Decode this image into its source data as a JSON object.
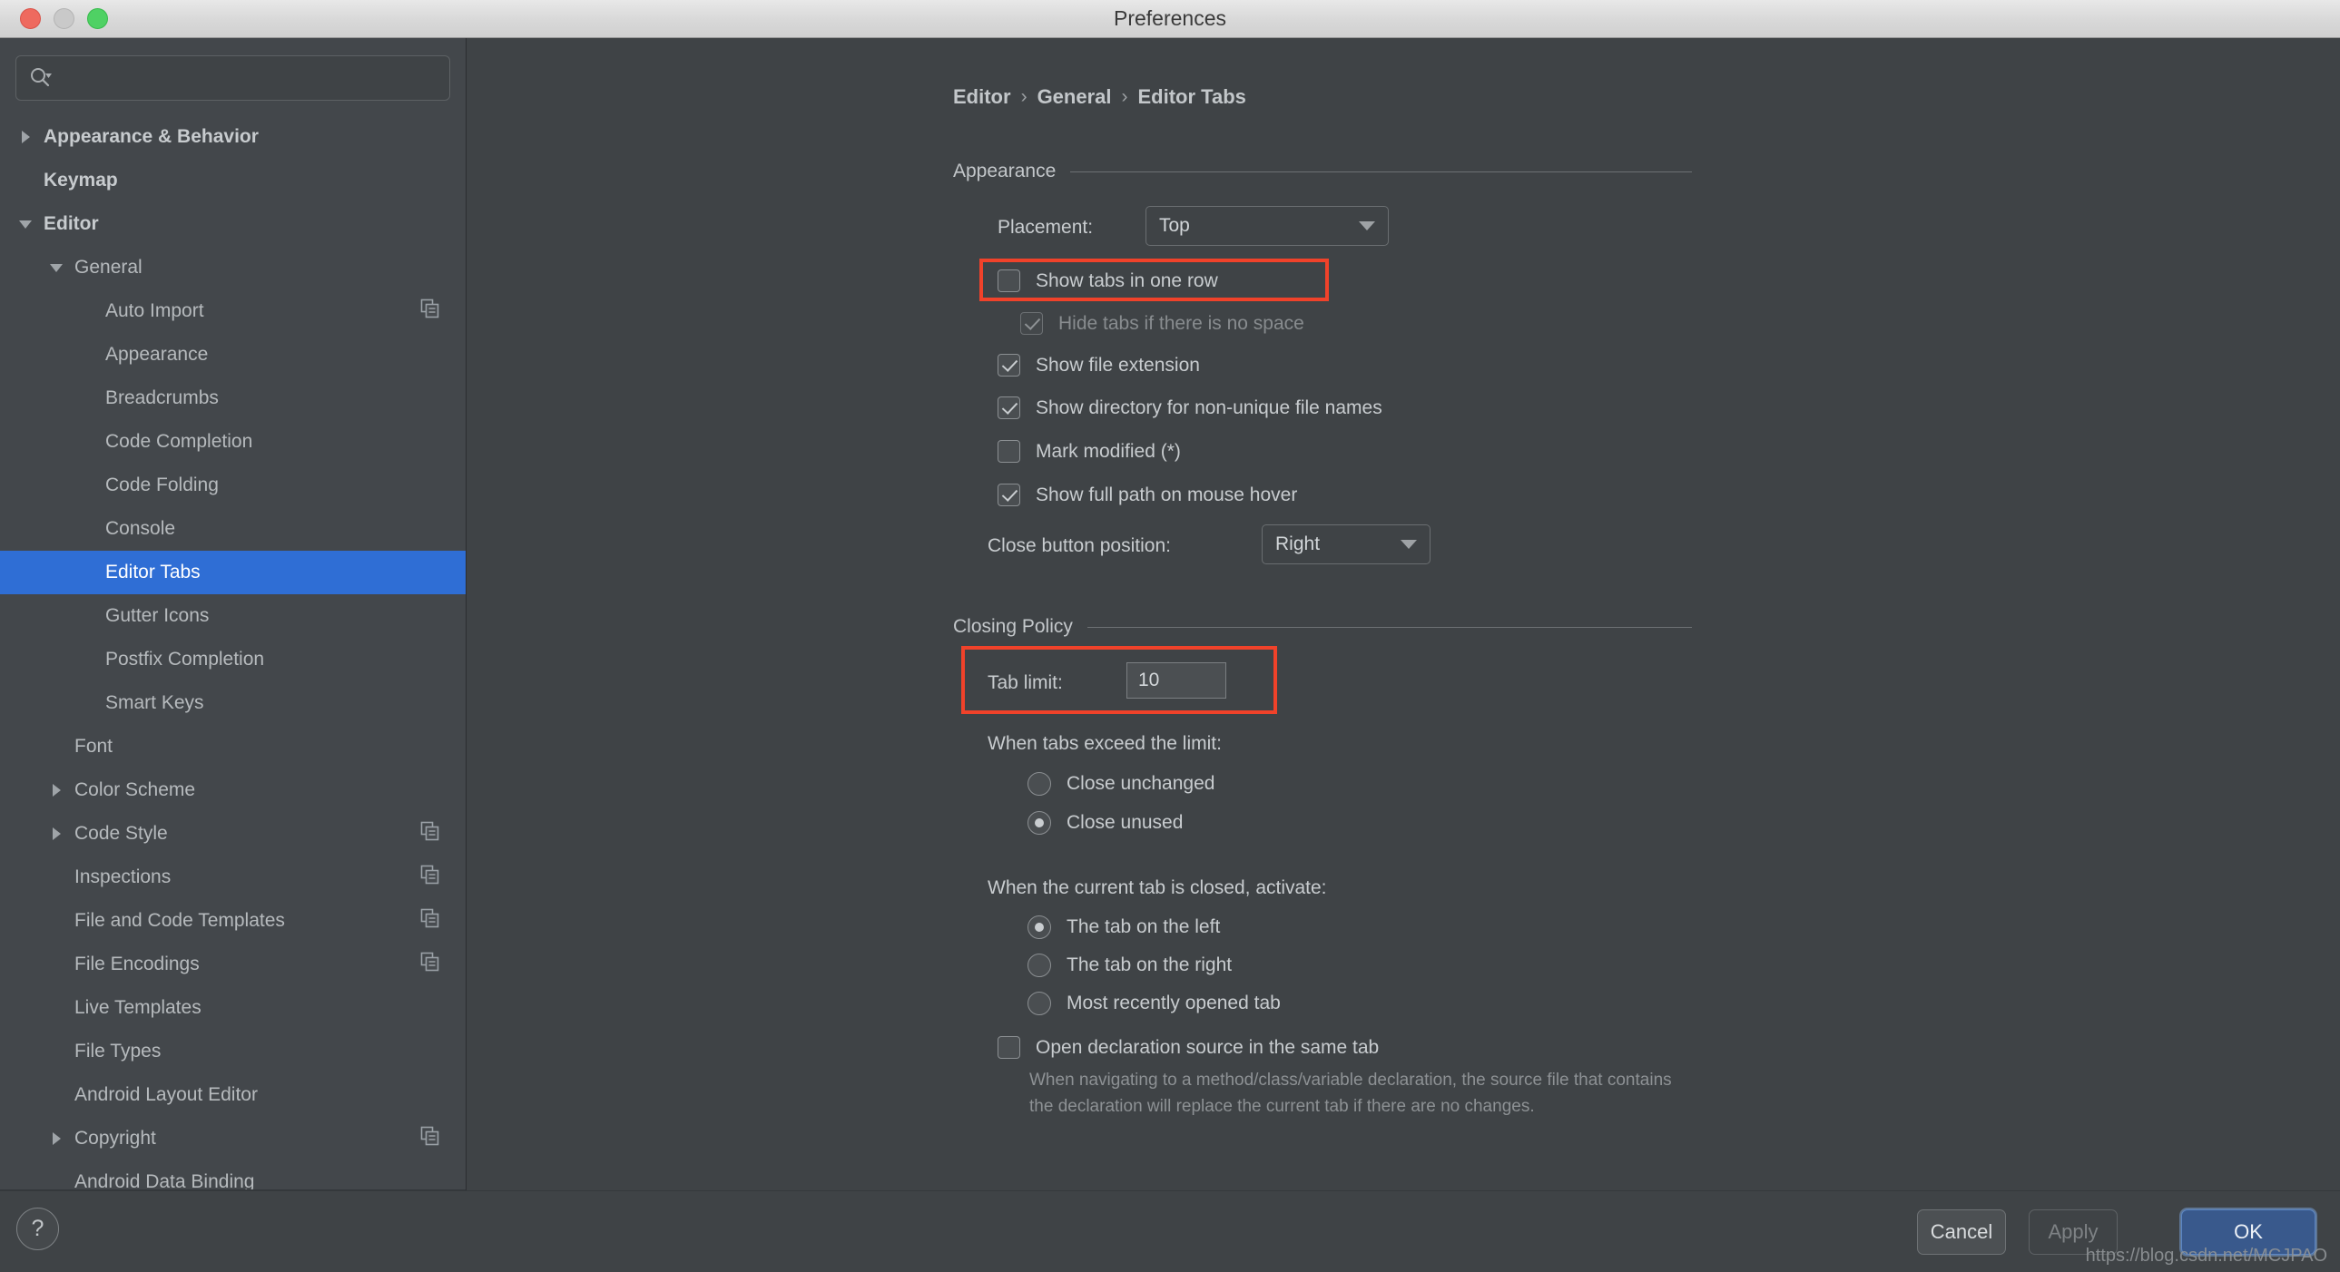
{
  "window": {
    "title": "Preferences",
    "traffic_lights": [
      "close-button",
      "minimize-button",
      "zoom-button"
    ]
  },
  "search": {
    "value": "",
    "placeholder": "",
    "icon": "search-icon"
  },
  "sidebar": {
    "items": [
      {
        "label": "Appearance & Behavior",
        "indent": 0,
        "arrow": "right",
        "bold": true,
        "selected": false,
        "copy_icon": false
      },
      {
        "label": "Keymap",
        "indent": 0,
        "arrow": "none",
        "bold": true,
        "selected": false,
        "copy_icon": false
      },
      {
        "label": "Editor",
        "indent": 0,
        "arrow": "down",
        "bold": true,
        "selected": false,
        "copy_icon": false
      },
      {
        "label": "General",
        "indent": 1,
        "arrow": "down",
        "bold": false,
        "selected": false,
        "copy_icon": false
      },
      {
        "label": "Auto Import",
        "indent": 2,
        "arrow": "none",
        "bold": false,
        "selected": false,
        "copy_icon": true
      },
      {
        "label": "Appearance",
        "indent": 2,
        "arrow": "none",
        "bold": false,
        "selected": false,
        "copy_icon": false
      },
      {
        "label": "Breadcrumbs",
        "indent": 2,
        "arrow": "none",
        "bold": false,
        "selected": false,
        "copy_icon": false
      },
      {
        "label": "Code Completion",
        "indent": 2,
        "arrow": "none",
        "bold": false,
        "selected": false,
        "copy_icon": false
      },
      {
        "label": "Code Folding",
        "indent": 2,
        "arrow": "none",
        "bold": false,
        "selected": false,
        "copy_icon": false
      },
      {
        "label": "Console",
        "indent": 2,
        "arrow": "none",
        "bold": false,
        "selected": false,
        "copy_icon": false
      },
      {
        "label": "Editor Tabs",
        "indent": 2,
        "arrow": "none",
        "bold": false,
        "selected": true,
        "copy_icon": false
      },
      {
        "label": "Gutter Icons",
        "indent": 2,
        "arrow": "none",
        "bold": false,
        "selected": false,
        "copy_icon": false
      },
      {
        "label": "Postfix Completion",
        "indent": 2,
        "arrow": "none",
        "bold": false,
        "selected": false,
        "copy_icon": false
      },
      {
        "label": "Smart Keys",
        "indent": 2,
        "arrow": "none",
        "bold": false,
        "selected": false,
        "copy_icon": false
      },
      {
        "label": "Font",
        "indent": 1,
        "arrow": "none",
        "bold": false,
        "selected": false,
        "copy_icon": false
      },
      {
        "label": "Color Scheme",
        "indent": 1,
        "arrow": "right",
        "bold": false,
        "selected": false,
        "copy_icon": false
      },
      {
        "label": "Code Style",
        "indent": 1,
        "arrow": "right",
        "bold": false,
        "selected": false,
        "copy_icon": true
      },
      {
        "label": "Inspections",
        "indent": 1,
        "arrow": "none",
        "bold": false,
        "selected": false,
        "copy_icon": true
      },
      {
        "label": "File and Code Templates",
        "indent": 1,
        "arrow": "none",
        "bold": false,
        "selected": false,
        "copy_icon": true
      },
      {
        "label": "File Encodings",
        "indent": 1,
        "arrow": "none",
        "bold": false,
        "selected": false,
        "copy_icon": true
      },
      {
        "label": "Live Templates",
        "indent": 1,
        "arrow": "none",
        "bold": false,
        "selected": false,
        "copy_icon": false
      },
      {
        "label": "File Types",
        "indent": 1,
        "arrow": "none",
        "bold": false,
        "selected": false,
        "copy_icon": false
      },
      {
        "label": "Android Layout Editor",
        "indent": 1,
        "arrow": "none",
        "bold": false,
        "selected": false,
        "copy_icon": false
      },
      {
        "label": "Copyright",
        "indent": 1,
        "arrow": "right",
        "bold": false,
        "selected": false,
        "copy_icon": true
      },
      {
        "label": "Android Data Binding",
        "indent": 1,
        "arrow": "none",
        "bold": false,
        "selected": false,
        "copy_icon": false
      }
    ]
  },
  "breadcrumb": {
    "items": [
      "Editor",
      "General",
      "Editor Tabs"
    ],
    "separator": "›"
  },
  "appearance": {
    "section_title": "Appearance",
    "placement_label": "Placement:",
    "placement_value": "Top",
    "checkboxes": [
      {
        "label": "Show tabs in one row",
        "checked": false,
        "disabled": false
      },
      {
        "label": "Hide tabs if there is no space",
        "checked": true,
        "disabled": true
      },
      {
        "label": "Show file extension",
        "checked": true,
        "disabled": false
      },
      {
        "label": "Show directory for non-unique file names",
        "checked": true,
        "disabled": false
      },
      {
        "label": "Mark modified (*)",
        "checked": false,
        "disabled": false
      },
      {
        "label": "Show full path on mouse hover",
        "checked": true,
        "disabled": false
      }
    ],
    "close_button_label": "Close button position:",
    "close_button_value": "Right"
  },
  "closing_policy": {
    "section_title": "Closing Policy",
    "tab_limit_label": "Tab limit:",
    "tab_limit_value": "10",
    "exceed_group_label": "When tabs exceed the limit:",
    "exceed_options": [
      {
        "label": "Close unchanged",
        "selected": false
      },
      {
        "label": "Close unused",
        "selected": true
      }
    ],
    "activate_group_label": "When the current tab is closed, activate:",
    "activate_options": [
      {
        "label": "The tab on the left",
        "selected": true
      },
      {
        "label": "The tab on the right",
        "selected": false
      },
      {
        "label": "Most recently opened tab",
        "selected": false
      }
    ],
    "open_declaration": {
      "label": "Open declaration source in the same tab",
      "checked": false,
      "description": "When navigating to a method/class/variable declaration, the source file that contains the declaration will replace the current tab if there are no changes."
    }
  },
  "footer": {
    "help_label": "?",
    "cancel_label": "Cancel",
    "apply_label": "Apply",
    "ok_label": "OK"
  },
  "watermark": "https://blog.csdn.net/MCJPAO",
  "colors": {
    "accent_selection": "#2f6ed5",
    "highlight_box": "#f0422a",
    "ok_button": "#39598c",
    "panel_bg": "#3f4346",
    "sidebar_bg": "#43474b"
  }
}
